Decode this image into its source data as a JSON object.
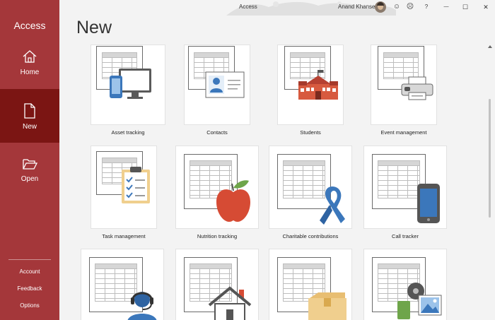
{
  "app": {
    "name": "Access",
    "window_title": "Access"
  },
  "user": {
    "name": "Anand Khanse"
  },
  "titlebar_icons": [
    "smile-icon",
    "frown-icon",
    "help-icon",
    "minimize-icon",
    "maximize-icon",
    "close-icon"
  ],
  "titlebar_glyphs": {
    "smile": "☺",
    "frown": "☹",
    "help": "?",
    "minimize": "—",
    "maximize": "☐",
    "close": "✕"
  },
  "nav": {
    "home": "Home",
    "new": "New",
    "open": "Open",
    "account": "Account",
    "feedback": "Feedback",
    "options": "Options"
  },
  "page": {
    "heading": "New"
  },
  "templates": [
    {
      "label": "Asset tracking",
      "icon": "computer-phone-icon"
    },
    {
      "label": "Contacts",
      "icon": "contact-card-icon"
    },
    {
      "label": "Students",
      "icon": "school-icon"
    },
    {
      "label": "Event management",
      "icon": "printer-icon"
    },
    {
      "label": "Task management",
      "icon": "clipboard-checklist-icon"
    },
    {
      "label": "Nutrition tracking",
      "icon": "apple-icon"
    },
    {
      "label": "Charitable contributions",
      "icon": "awareness-ribbon-icon"
    },
    {
      "label": "Call tracker",
      "icon": "mobile-phone-icon"
    },
    {
      "label": "",
      "icon": "headset-agent-icon"
    },
    {
      "label": "",
      "icon": "house-icon"
    },
    {
      "label": "",
      "icon": "package-box-icon"
    },
    {
      "label": "",
      "icon": "photo-media-icon"
    }
  ],
  "colors": {
    "accent": "#a4373a",
    "accent_dark": "#7b1513"
  }
}
